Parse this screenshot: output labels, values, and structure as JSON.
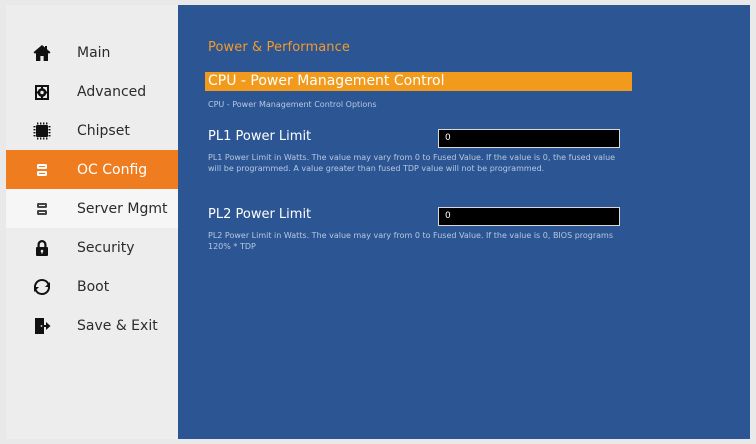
{
  "sidebar": {
    "items": [
      {
        "label": "Main",
        "icon": "home-icon"
      },
      {
        "label": "Advanced",
        "icon": "gear-icon"
      },
      {
        "label": "Chipset",
        "icon": "chip-icon"
      },
      {
        "label": "OC Config",
        "icon": "server-icon",
        "active": true
      },
      {
        "label": "Server Mgmt",
        "icon": "server-icon"
      },
      {
        "label": "Security",
        "icon": "lock-icon"
      },
      {
        "label": "Boot",
        "icon": "refresh-icon"
      },
      {
        "label": "Save & Exit",
        "icon": "exit-icon"
      }
    ]
  },
  "content": {
    "section_title": "Power & Performance",
    "selected_item": {
      "label": "CPU - Power Management Control",
      "help": "CPU - Power Management Control Options"
    },
    "settings": [
      {
        "label": "PL1 Power Limit",
        "value": "0",
        "help": "PL1 Power Limit in Watts. The value may vary from 0 to Fused Value. If the value is 0, the fused value will be programmed. A value greater than fused TDP value will not be programmed."
      },
      {
        "label": "PL2 Power Limit",
        "value": "0",
        "help": "PL2 Power Limit in Watts. The value may vary from 0 to Fused Value. If the value is 0, BIOS programs 120% * TDP"
      }
    ]
  },
  "colors": {
    "accent": "#ef7d1f",
    "highlight": "#f19a1c",
    "panel": "#2c5593",
    "sidebar": "#ededed"
  }
}
